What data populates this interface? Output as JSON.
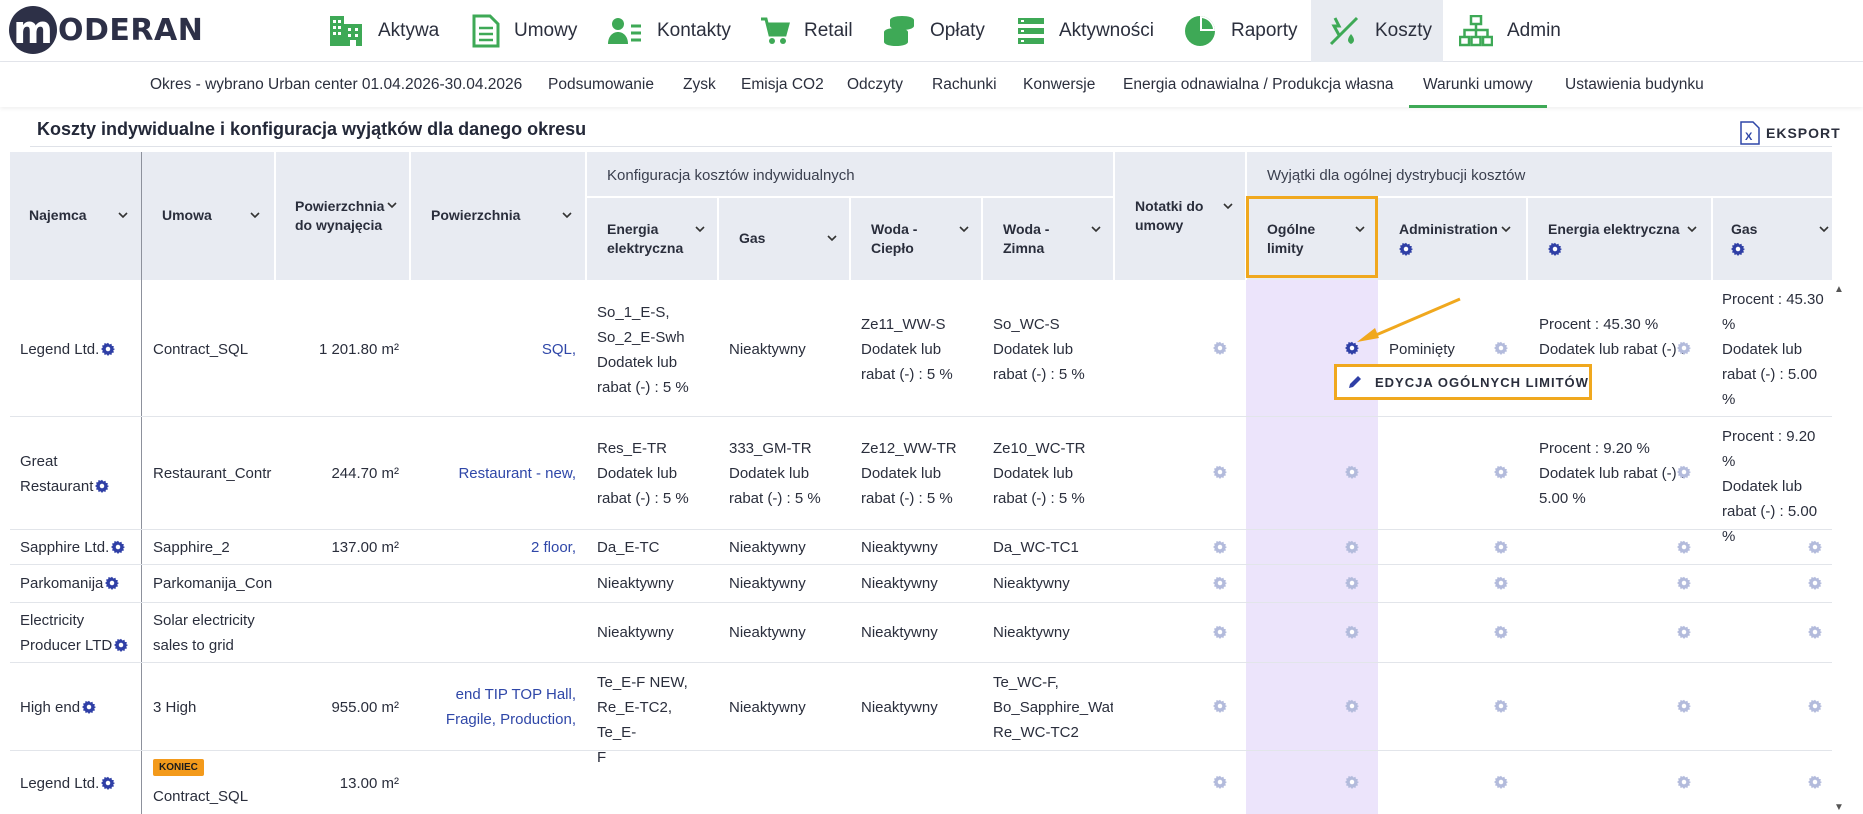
{
  "logo": {
    "letter": "m",
    "text": "ODERAN"
  },
  "nav": [
    {
      "label": "Aktywa",
      "icon": "building-icon"
    },
    {
      "label": "Umowy",
      "icon": "document-icon"
    },
    {
      "label": "Kontakty",
      "icon": "contacts-icon"
    },
    {
      "label": "Retail",
      "icon": "cart-icon"
    },
    {
      "label": "Opłaty",
      "icon": "coins-icon"
    },
    {
      "label": "Aktywności",
      "icon": "list-icon"
    },
    {
      "label": "Raporty",
      "icon": "pie-chart-icon"
    },
    {
      "label": "Koszty",
      "icon": "costs-icon",
      "active": true
    },
    {
      "label": "Admin",
      "icon": "hierarchy-icon"
    }
  ],
  "subnav": [
    "Okres - wybrano Urban center 01.04.2026-30.04.2026",
    "Podsumowanie",
    "Zysk",
    "Emisja CO2",
    "Odczyty",
    "Rachunki",
    "Konwersje",
    "Energia odnawialna / Produkcja własna",
    "Warunki umowy",
    "Ustawienia budynku"
  ],
  "subnav_selected": "Warunki umowy",
  "section_title": "Koszty indywidualne i konfiguracja wyjątków dla danego okresu",
  "export_label": "EKSPORT",
  "colors": {
    "accent_green": "#3ea956",
    "highlight_orange": "#f0a81e",
    "link_blue": "#2f47a8",
    "gear_blue": "#2f3fa6",
    "highlight_column": "#ece4fb"
  },
  "headers": {
    "najemca": "Najemca",
    "umowa": "Umowa",
    "pow_wynajem_1": "Powierzchnia",
    "pow_wynajem_2": "do wynajęcia",
    "powierzchnia": "Powierzchnia",
    "group_indywidualne": "Konfiguracja kosztów indywidualnych",
    "energia_1": "Energia",
    "energia_2": "elektryczna",
    "gas": "Gas",
    "woda_cieplo_1": "Woda -",
    "woda_cieplo_2": "Ciepło",
    "woda_zimna_1": "Woda -",
    "woda_zimna_2": "Zimna",
    "notatki_1": "Notatki do",
    "notatki_2": "umowy",
    "group_wyjatki": "Wyjątki dla ogólnej dystrybucji kosztów",
    "ogolne_1": "Ogólne",
    "ogolne_2": "limity",
    "administration": "Administration",
    "ex_energia": "Energia elektryczna",
    "ex_gas": "Gas"
  },
  "rows": [
    {
      "najemca": "Legend Ltd.",
      "umowa": "Contract_SQL",
      "area": "1 201.80 m²",
      "pow": "SQL,",
      "energia": [
        "So_1_E-S,",
        "So_2_E-Swh",
        "Dodatek lub",
        "rabat (-) : 5 %"
      ],
      "gas": [
        "Nieaktywny"
      ],
      "woda_c": [
        "Ze11_WW-S",
        "Dodatek lub",
        "rabat (-) : 5 %"
      ],
      "woda_z": [
        "So_WC-S",
        "Dodatek lub",
        "rabat (-) : 5 %"
      ],
      "admin": "Pominięty",
      "ex_energia": [
        "Procent : 45.30 %",
        "Dodatek lub rabat (-) :"
      ],
      "ex_gas": [
        "Procent : 45.30",
        "%",
        "Dodatek lub",
        "rabat (-) : 5.00",
        "%"
      ]
    },
    {
      "najemca_1": "Great",
      "najemca_2": "Restaurant",
      "umowa": "Restaurant_Contr",
      "area": "244.70 m²",
      "pow": "Restaurant - new,",
      "energia": [
        "Res_E-TR",
        "Dodatek lub",
        "rabat (-) : 5 %"
      ],
      "gas": [
        "333_GM-TR",
        "Dodatek lub",
        "rabat (-) : 5 %"
      ],
      "woda_c": [
        "Ze12_WW-TR",
        "Dodatek lub",
        "rabat (-) : 5 %"
      ],
      "woda_z": [
        "Ze10_WC-TR",
        "Dodatek lub",
        "rabat (-) : 5 %"
      ],
      "ex_energia": [
        "Procent : 9.20 %",
        "Dodatek lub rabat (-) :",
        "5.00 %"
      ],
      "ex_gas": [
        "Procent : 9.20 %",
        "Dodatek lub",
        "rabat (-) : 5.00",
        "%"
      ]
    },
    {
      "najemca": "Sapphire Ltd.",
      "umowa": "Sapphire_2",
      "area": "137.00 m²",
      "pow": "2 floor,",
      "energia": "Da_E-TC",
      "gas": "Nieaktywny",
      "woda_c": "Nieaktywny",
      "woda_z": "Da_WC-TC1"
    },
    {
      "najemca": "Parkomanija",
      "umowa": "Parkomanija_Con",
      "energia": "Nieaktywny",
      "gas": "Nieaktywny",
      "woda_c": "Nieaktywny",
      "woda_z": "Nieaktywny"
    },
    {
      "najemca_1": "Electricity",
      "najemca_2": "Producer LTD",
      "umowa_1": "Solar electricity",
      "umowa_2": "sales to grid",
      "energia": "Nieaktywny",
      "gas": "Nieaktywny",
      "woda_c": "Nieaktywny",
      "woda_z": "Nieaktywny"
    },
    {
      "najemca": "High end",
      "umowa": "3 High",
      "area": "955.00 m²",
      "pow_1": "end TIP TOP Hall,",
      "pow_2": "Fragile, Production,",
      "energia": [
        "Te_E-F NEW,",
        "Re_E-TC2, Te_E-",
        "F"
      ],
      "gas": "Nieaktywny",
      "woda_c": "Nieaktywny",
      "woda_z": [
        "Te_WC-F,",
        "Bo_Sapphire_Wate",
        "Re_WC-TC2"
      ]
    },
    {
      "najemca": "Legend Ltd.",
      "badge": "KONIEC",
      "umowa": "Contract_SQL",
      "area": "13.00 m²"
    }
  ],
  "popup_label": "EDYCJA OGÓLNYCH LIMITÓW"
}
